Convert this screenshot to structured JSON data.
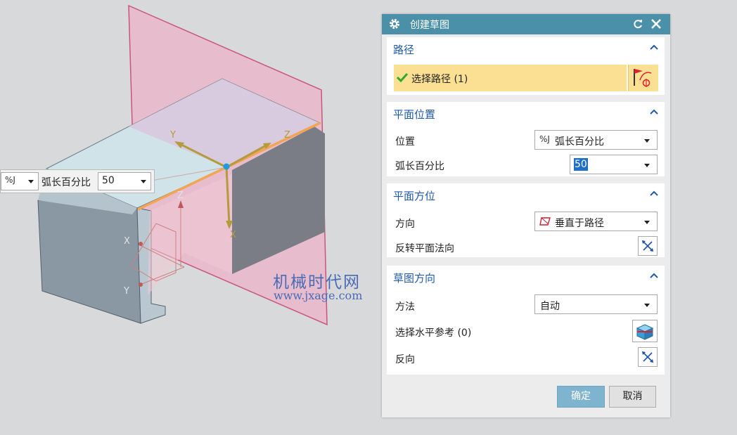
{
  "viewport": {
    "colors": {
      "background": "#d7d9da",
      "plane": "#e7bccc",
      "plane_edge": "#c9557f",
      "path_edge": "#f2a552",
      "part_top": "#c6dfe5",
      "part_side": "#7a7f8a"
    },
    "axes": {
      "top": [
        "Y",
        "Z",
        "X"
      ],
      "left": [
        "Z",
        "X",
        "Y"
      ]
    },
    "float_bar": {
      "icon": "%J",
      "label": "弧长百分比",
      "value": "50"
    },
    "watermark": {
      "line1": "机械时代网",
      "line2": "www.jxage.com"
    }
  },
  "dialog": {
    "title": "创建草图",
    "colors": {
      "titlebar": "#4a90a9",
      "section_title": "#1f59a8",
      "selected_row": "#fbe093",
      "ok_button": "#7fb4ce"
    },
    "sections": {
      "path": {
        "title": "路径",
        "selection_label": "选择路径 (1)"
      },
      "plane_position": {
        "title": "平面位置",
        "location_label": "位置",
        "location_icon": "%J",
        "location_value": "弧长百分比",
        "arc_percent_label": "弧长百分比",
        "arc_percent_value": "50"
      },
      "plane_orientation": {
        "title": "平面方位",
        "direction_label": "方向",
        "direction_value": "垂直于路径",
        "reverse_normal_label": "反转平面法向"
      },
      "sketch_orientation": {
        "title": "草图方向",
        "method_label": "方法",
        "method_value": "自动",
        "horizontal_ref_label": "选择水平参考 (0)",
        "reverse_label": "反向"
      }
    },
    "buttons": {
      "ok": "确定",
      "cancel": "取消"
    }
  }
}
